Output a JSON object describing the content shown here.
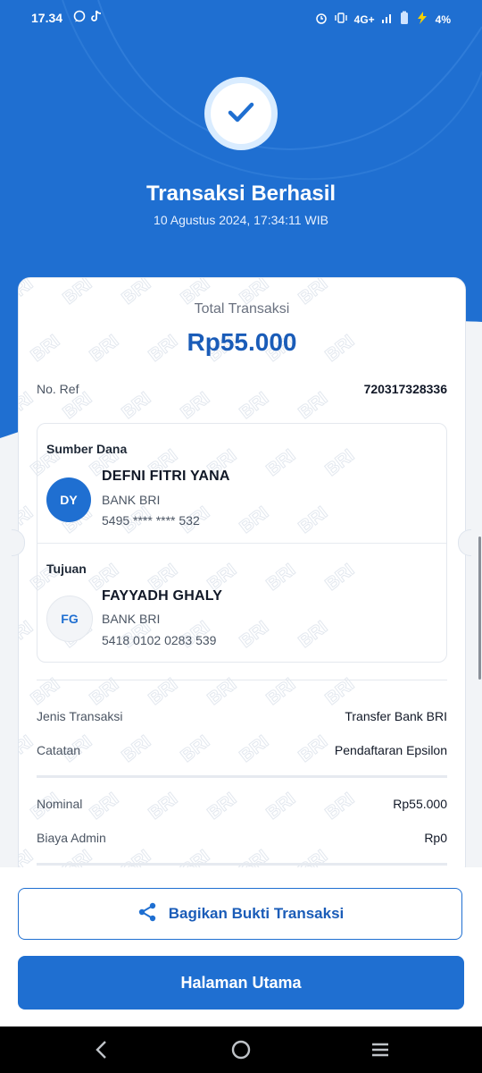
{
  "status_bar": {
    "time": "17.34",
    "network": "4G+",
    "battery": "4%",
    "icons": [
      "whatsapp-icon",
      "tiktok-icon",
      "alarm-icon",
      "vibrate-icon",
      "signal-icon",
      "battery-icon",
      "charging-icon"
    ]
  },
  "header": {
    "title": "Transaksi Berhasil",
    "datetime": "10 Agustus 2024, 17:34:11 WIB",
    "icon": "check-icon"
  },
  "summary": {
    "total_label": "Total Transaksi",
    "total_value": "Rp55.000",
    "ref_label": "No. Ref",
    "ref_value": "720317328336"
  },
  "source": {
    "heading": "Sumber Dana",
    "initials": "DY",
    "name": "DEFNI FITRI YANA",
    "bank": "BANK BRI",
    "account": "5495 **** **** 532"
  },
  "destination": {
    "heading": "Tujuan",
    "initials": "FG",
    "name": "FAYYADH GHALY",
    "bank": "BANK BRI",
    "account": "5418 0102 0283 539"
  },
  "details": [
    {
      "label": "Jenis Transaksi",
      "value": "Transfer Bank BRI"
    },
    {
      "label": "Catatan",
      "value": "Pendaftaran Epsilon"
    },
    {
      "label": "Nominal",
      "value": "Rp55.000"
    },
    {
      "label": "Biaya Admin",
      "value": "Rp0"
    }
  ],
  "watermark_text": "BRI",
  "actions": {
    "share_label": "Bagikan Bukti Transaksi",
    "home_label": "Halaman Utama"
  },
  "colors": {
    "primary": "#1f6fd1",
    "primary_dark": "#1a5cb8",
    "background": "#f2f4f7"
  }
}
